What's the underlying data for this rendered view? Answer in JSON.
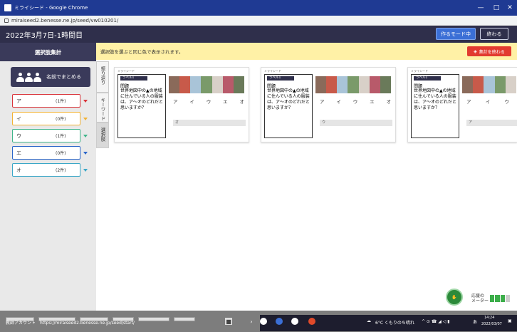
{
  "chrome": {
    "window_title": "ミライシード - Google Chrome",
    "url": "miraiseed2.benesse.ne.jp/seed/vw010201/",
    "min": "—",
    "max": "□",
    "close": "✕"
  },
  "header": {
    "title": "2022年3月7日-1時間目",
    "mode_button": "作るモード中",
    "end_button": "終わる"
  },
  "left": {
    "heading": "選択肢集計",
    "group_button": "名前でまとめる",
    "choices": [
      {
        "label": "ア",
        "count": "(1件)",
        "color": "#d9343a"
      },
      {
        "label": "イ",
        "count": "(0件)",
        "color": "#f2b233"
      },
      {
        "label": "ウ",
        "count": "(1件)",
        "color": "#3fb58a"
      },
      {
        "label": "エ",
        "count": "(0件)",
        "color": "#2a66c9"
      },
      {
        "label": "オ",
        "count": "(2件)",
        "color": "#3aa7c7"
      }
    ]
  },
  "tabs": [
    "振り返り",
    "キーワード",
    "選択肢"
  ],
  "banner": {
    "text": "選択肢を選ぶと同じ色で表示されます。",
    "end_button": "集計を終わる"
  },
  "cards": [
    {
      "tag": "ミライシード",
      "label": "ラベル1",
      "title": "問題",
      "question": "世界地図中の▲の地域に住んでいる人の服装は、ア〜オのどれだと思いますか？",
      "options": [
        "ア",
        "イ",
        "ウ",
        "エ",
        "オ"
      ],
      "answer": "オ"
    },
    {
      "tag": "ミライシード",
      "label": "ラベル1",
      "title": "問題",
      "question": "世界地図中の▲の地域に住んでいる人の服装は、ア〜オのどれだと思いますか？",
      "options": [
        "ア",
        "イ",
        "ウ",
        "エ",
        "オ"
      ],
      "answer": "ウ"
    },
    {
      "tag": "ミライシード",
      "label": "ラベル1",
      "title": "問題",
      "question": "世界地図中の▲の地域に住んでいる人の服装は、ア〜オのどれだと思いますか？",
      "options": [
        "ア",
        "イ",
        "ウ"
      ],
      "answer": "ア"
    }
  ],
  "footer": {
    "bottom_text": "教師アカウント　https://miraiseed2.benesse.ne.jp/seed/start/",
    "meter_label_1": "応援の",
    "meter_label_2": "メーター",
    "mic_text": "応援"
  },
  "taskbar": {
    "weather": "6°C くもりのち晴れ",
    "ime": "あ",
    "time": "14:24",
    "date": "2022/03/07"
  }
}
